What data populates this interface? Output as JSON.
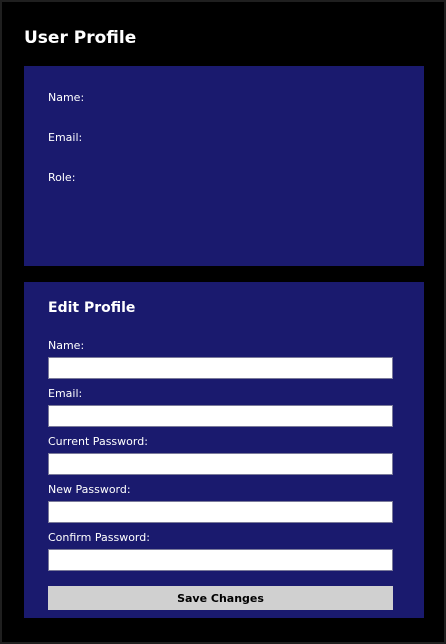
{
  "header": {
    "title": "User Profile"
  },
  "profile_info": {
    "name_label": "Name:",
    "name_value": "",
    "email_label": "Email:",
    "email_value": "",
    "role_label": "Role:",
    "role_value": ""
  },
  "edit_profile": {
    "title": "Edit Profile",
    "name_label": "Name:",
    "name_value": "",
    "email_label": "Email:",
    "email_value": "",
    "current_password_label": "Current Password:",
    "current_password_value": "",
    "new_password_label": "New Password:",
    "new_password_value": "",
    "confirm_password_label": "Confirm Password:",
    "confirm_password_value": "",
    "save_label": "Save Changes"
  },
  "colors": {
    "background": "#000000",
    "panel": "#1a1a6e",
    "button": "#d0d0d0",
    "text": "#ffffff"
  }
}
